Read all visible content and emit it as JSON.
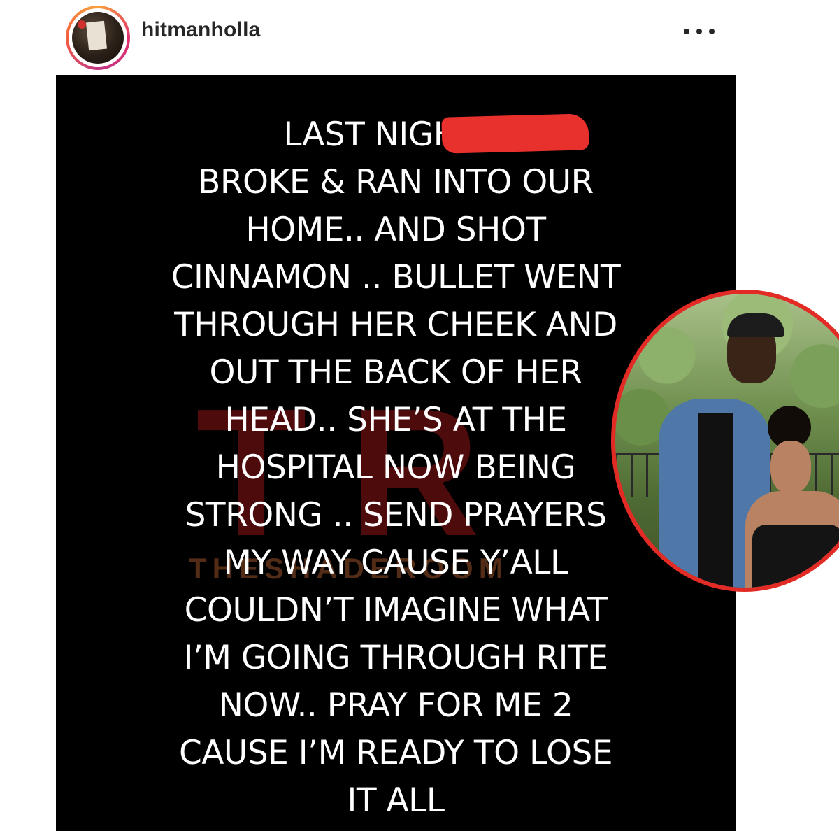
{
  "post": {
    "username": "hitmanholla",
    "more_icon": "ellipsis-icon",
    "story_lines": [
      "LAST NIGHT 4",
      "BROKE & RAN INTO OUR",
      "HOME.. AND SHOT",
      "CINNAMON .. BULLET WENT",
      "THROUGH HER CHEEK AND",
      "OUT THE BACK OF HER",
      "HEAD.. SHE’S AT THE",
      "HOSPITAL NOW BEING",
      "STRONG .. SEND PRAYERS",
      "MY WAY CAUSE Y’ALL",
      "COULDN’T IMAGINE WHAT",
      "I’M GOING THROUGH RITE",
      "NOW.. PRAY FOR ME 2",
      "CAUSE I’M READY TO LOSE",
      "IT ALL"
    ],
    "watermark": "TR",
    "watermark_sub": "THESHADEROOM"
  },
  "colors": {
    "redaction": "#e8312c",
    "photo_ring": "#e32b26",
    "post_background": "#000000",
    "text": "#ffffff"
  }
}
